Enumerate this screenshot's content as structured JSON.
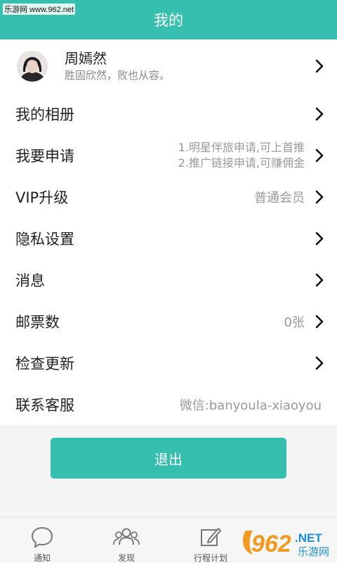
{
  "watermark": "乐游网 www.962.net",
  "header": {
    "title": "我的"
  },
  "profile": {
    "name": "周嫣然",
    "motto": "胜固欣然，败也从容。"
  },
  "menu": [
    {
      "label": "我的相册",
      "value": ""
    },
    {
      "label": "我要申请",
      "value_lines": [
        "1.明星伴旅申请,可上首推",
        "2.推广链接申请,可赚佣金"
      ]
    },
    {
      "label": "VIP升级",
      "value": "普通会员"
    },
    {
      "label": "隐私设置",
      "value": ""
    },
    {
      "label": "消息",
      "value": ""
    },
    {
      "label": "邮票数",
      "value": "0张"
    },
    {
      "label": "检查更新",
      "value": ""
    },
    {
      "label": "联系客服",
      "value": "微信:banyoula-xiaoyou"
    }
  ],
  "logout_label": "退出",
  "tabs": [
    {
      "label": "通知",
      "icon": "chat-bubble-icon"
    },
    {
      "label": "发现",
      "icon": "people-icon"
    },
    {
      "label": "行程计划",
      "icon": "edit-note-icon"
    }
  ],
  "logo": {
    "text_962": "962",
    "text_net": ".NET",
    "text_cn": "乐游网"
  },
  "colors": {
    "accent": "#36bfae",
    "logo_orange": "#f39a1e",
    "logo_blue": "#1d8fd6"
  }
}
